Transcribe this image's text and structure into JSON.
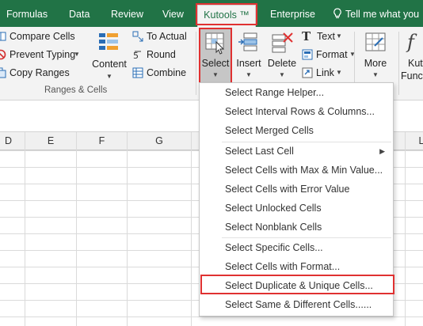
{
  "tabs": [
    {
      "label": "Formulas"
    },
    {
      "label": "Data"
    },
    {
      "label": "Review"
    },
    {
      "label": "View"
    },
    {
      "label": "Kutools ™"
    },
    {
      "label": "Enterprise"
    }
  ],
  "tell_me": "Tell me what you",
  "ribbon": {
    "range_cells": {
      "compare_cells": "Compare Cells",
      "prevent_typing": "Prevent Typing",
      "copy_ranges": "Copy Ranges",
      "content": "Content",
      "to_actual": "To Actual",
      "round": "Round",
      "combine": "Combine",
      "group_label": "Ranges & Cells"
    },
    "select": "Select",
    "insert": "Insert",
    "delete": "Delete",
    "text": "Text",
    "format": "Format",
    "link": "Link",
    "more": "More",
    "kutools_functions_1": "Kut",
    "kutools_functions_2": "Funct"
  },
  "columns": [
    "D",
    "E",
    "F",
    "G",
    "L"
  ],
  "colors": {
    "accent": "#217346",
    "highlight": "#e03131"
  },
  "menu": {
    "items": [
      {
        "label": "Select Range Helper..."
      },
      {
        "label": "Select Interval Rows & Columns..."
      },
      {
        "label": "Select Merged Cells"
      },
      {
        "label": "Select Last Cell"
      },
      {
        "label": "Select Cells with Max & Min Value..."
      },
      {
        "label": "Select Cells with Error Value"
      },
      {
        "label": "Select Unlocked Cells"
      },
      {
        "label": "Select Nonblank Cells"
      },
      {
        "label": "Select Specific Cells..."
      },
      {
        "label": "Select Cells with Format..."
      },
      {
        "label": "Select Duplicate & Unique Cells..."
      },
      {
        "label": "Select Same & Different Cells......"
      }
    ]
  }
}
